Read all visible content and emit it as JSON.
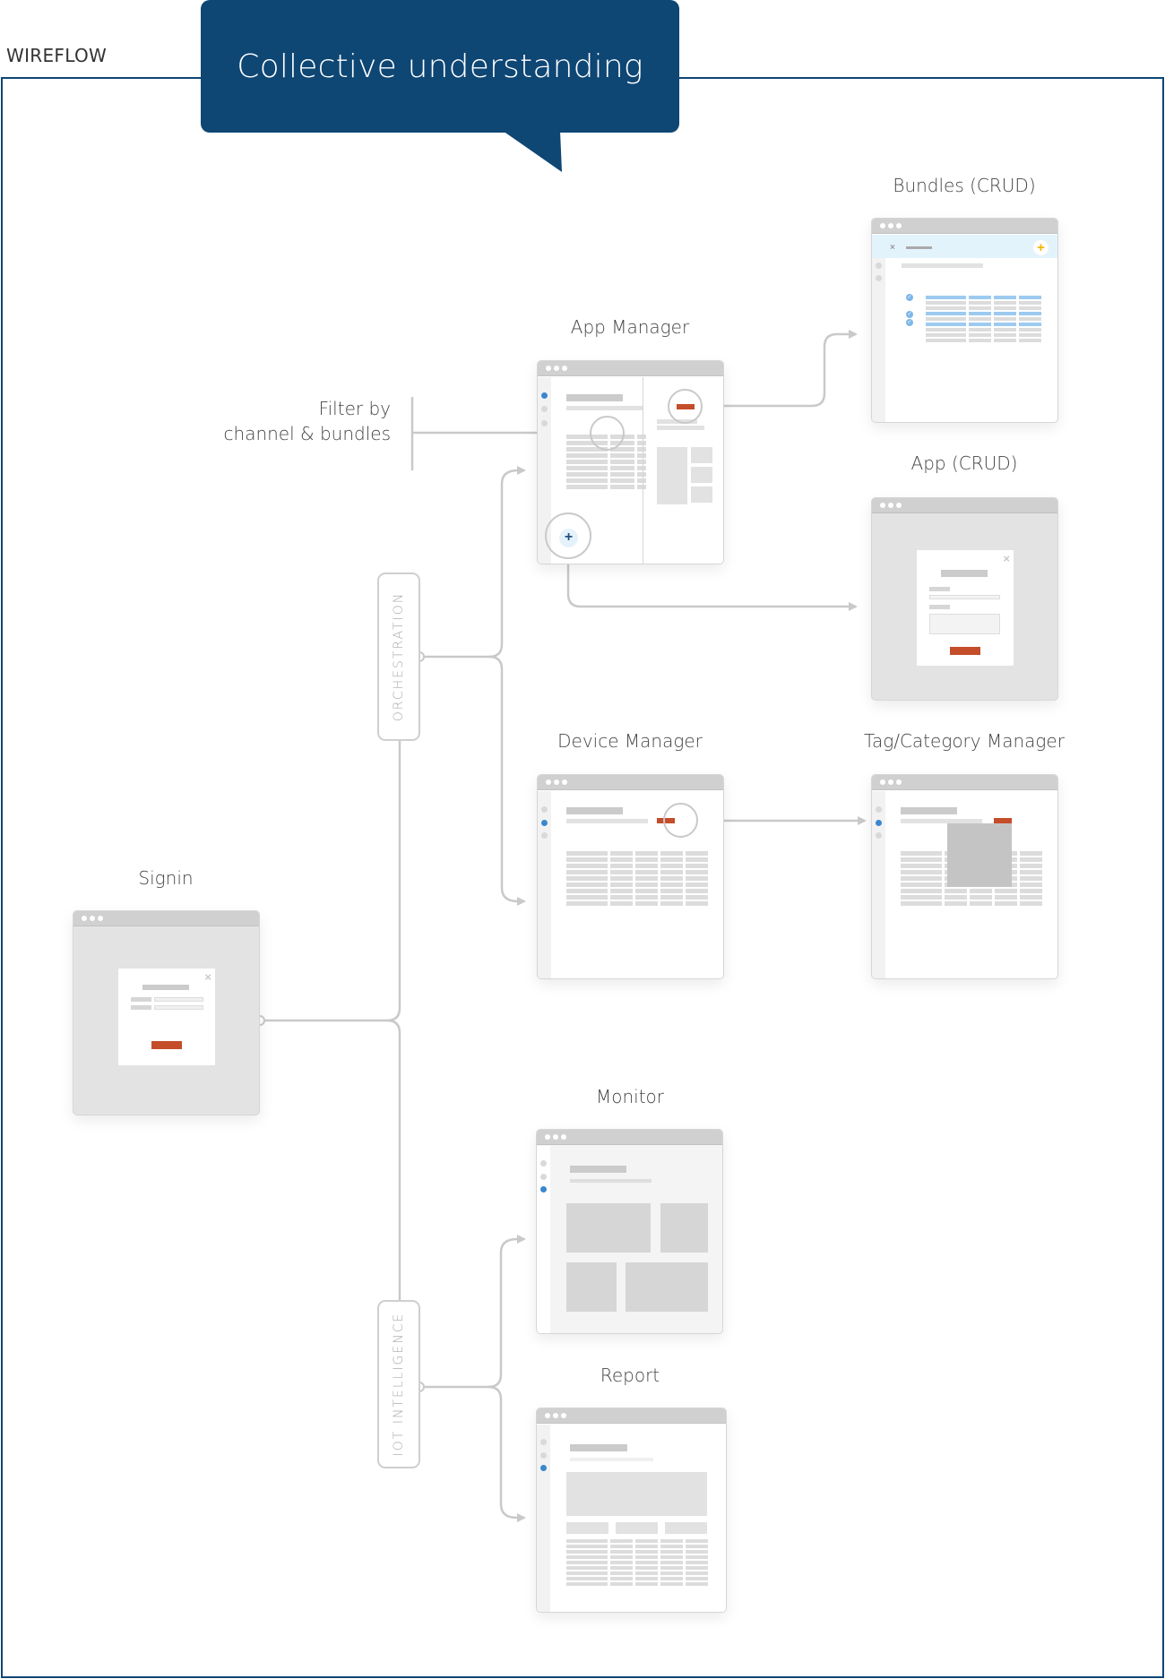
{
  "header": {
    "section_label": "WIREFLOW",
    "callout_text": "Collective understanding"
  },
  "colors": {
    "frame": "#0e4674",
    "callout_bg": "#0e4674",
    "connector": "#c9c9c9",
    "accent_blue": "#3a87cf",
    "action_red": "#c44d2a",
    "add_yellow": "#f5b400",
    "selected_row_blue": "#9ccaf0"
  },
  "annotations": {
    "filter_line1": "Filter by",
    "filter_line2": "channel & bundles"
  },
  "groups": [
    {
      "label": "ORCHESTRATION"
    },
    {
      "label": "IOT INTELLIGENCE"
    }
  ],
  "screens": {
    "signin": {
      "title": "Signin",
      "close_icon": "×"
    },
    "app_manager": {
      "title": "App Manager",
      "add_icon": "+"
    },
    "bundles": {
      "title": "Bundles (CRUD)",
      "close_icon": "×",
      "add_icon": "+"
    },
    "app_crud": {
      "title": "App (CRUD)",
      "close_icon": "×"
    },
    "device_manager": {
      "title": "Device Manager"
    },
    "tag_manager": {
      "title": "Tag/Category Manager"
    },
    "monitor": {
      "title": "Monitor"
    },
    "report": {
      "title": "Report"
    }
  }
}
